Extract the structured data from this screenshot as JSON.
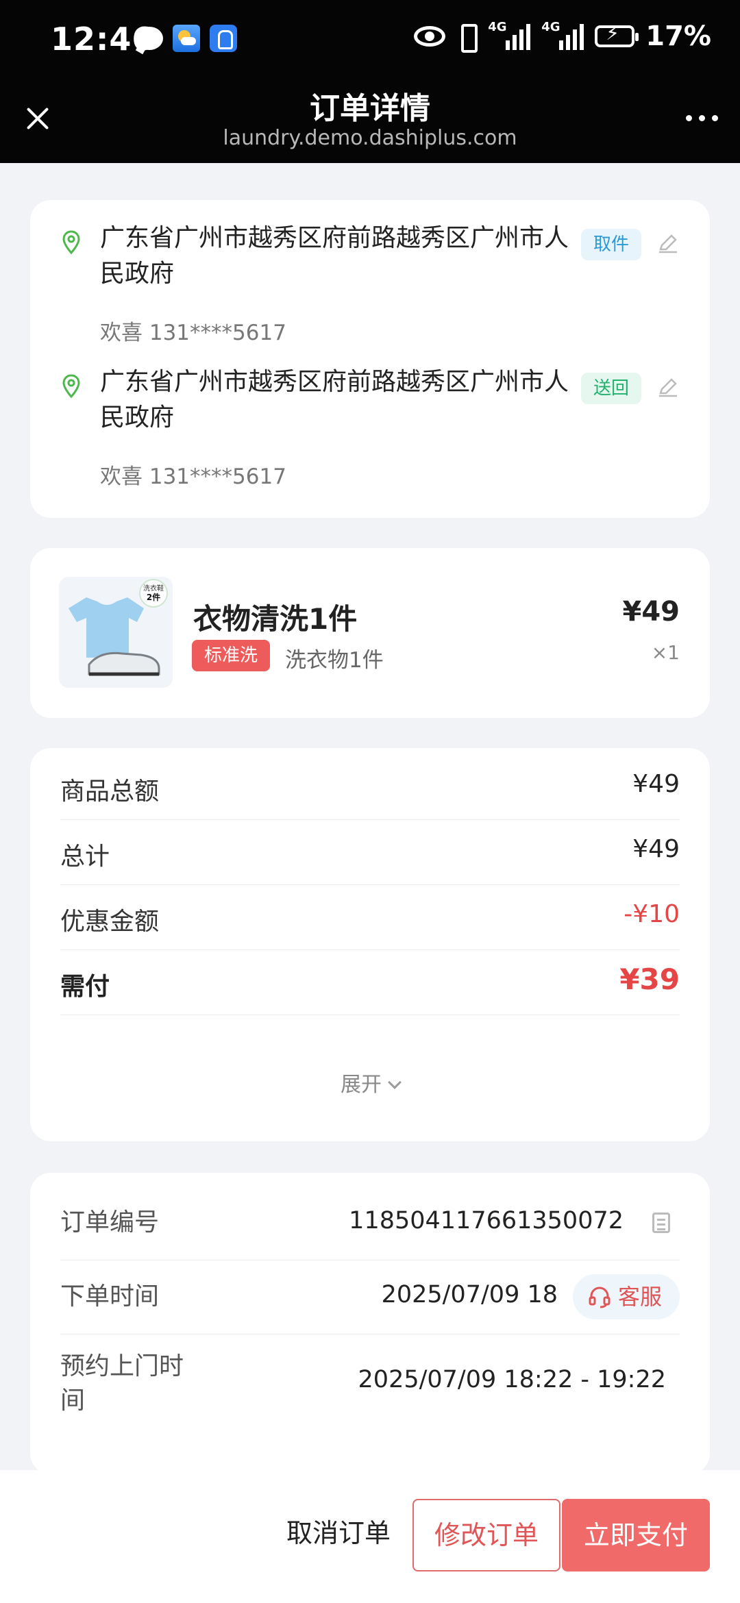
{
  "status_bar": {
    "time": "12:46",
    "network_label_1": "4G",
    "network_label_2": "4G",
    "battery": "17%"
  },
  "header": {
    "title": "订单详情",
    "url": "laundry.demo.dashiplus.com"
  },
  "addresses": [
    {
      "address": "广东省广州市越秀区府前路越秀区广州市人民政府",
      "contact": "欢喜 131****5617",
      "tag": "取件"
    },
    {
      "address": "广东省广州市越秀区府前路越秀区广州市人民政府",
      "contact": "欢喜 131****5617",
      "tag": "送回"
    }
  ],
  "item": {
    "thumb_badge_line1": "洗衣鞋",
    "thumb_badge_line2": "2件",
    "name": "衣物清洗1件",
    "badge": "标准洗",
    "desc": "洗衣物1件",
    "price": "¥49",
    "qty": "×1"
  },
  "pricing": {
    "rows": [
      {
        "label": "商品总额",
        "value": "¥49"
      },
      {
        "label": "总计",
        "value": "¥49"
      },
      {
        "label": "优惠金额",
        "value": "-¥10"
      },
      {
        "label": "需付",
        "value": "¥39"
      }
    ],
    "expand_label": "展开"
  },
  "order_info": {
    "number_label": "订单编号",
    "number_value": "118504117661350072",
    "time_label": "下单时间",
    "time_value": "2025/07/09 18",
    "service_label": "客服",
    "appointment_label_line1": "预约上门时",
    "appointment_label_line2": "间",
    "appointment_value": "2025/07/09 18:22 - 19:22"
  },
  "actions": {
    "cancel": "取消订单",
    "modify": "修改订单",
    "pay": "立即支付"
  },
  "colors": {
    "accent_red": "#f06a6a",
    "pickup_tag": "#2a9bd6",
    "return_tag": "#20b26d"
  }
}
